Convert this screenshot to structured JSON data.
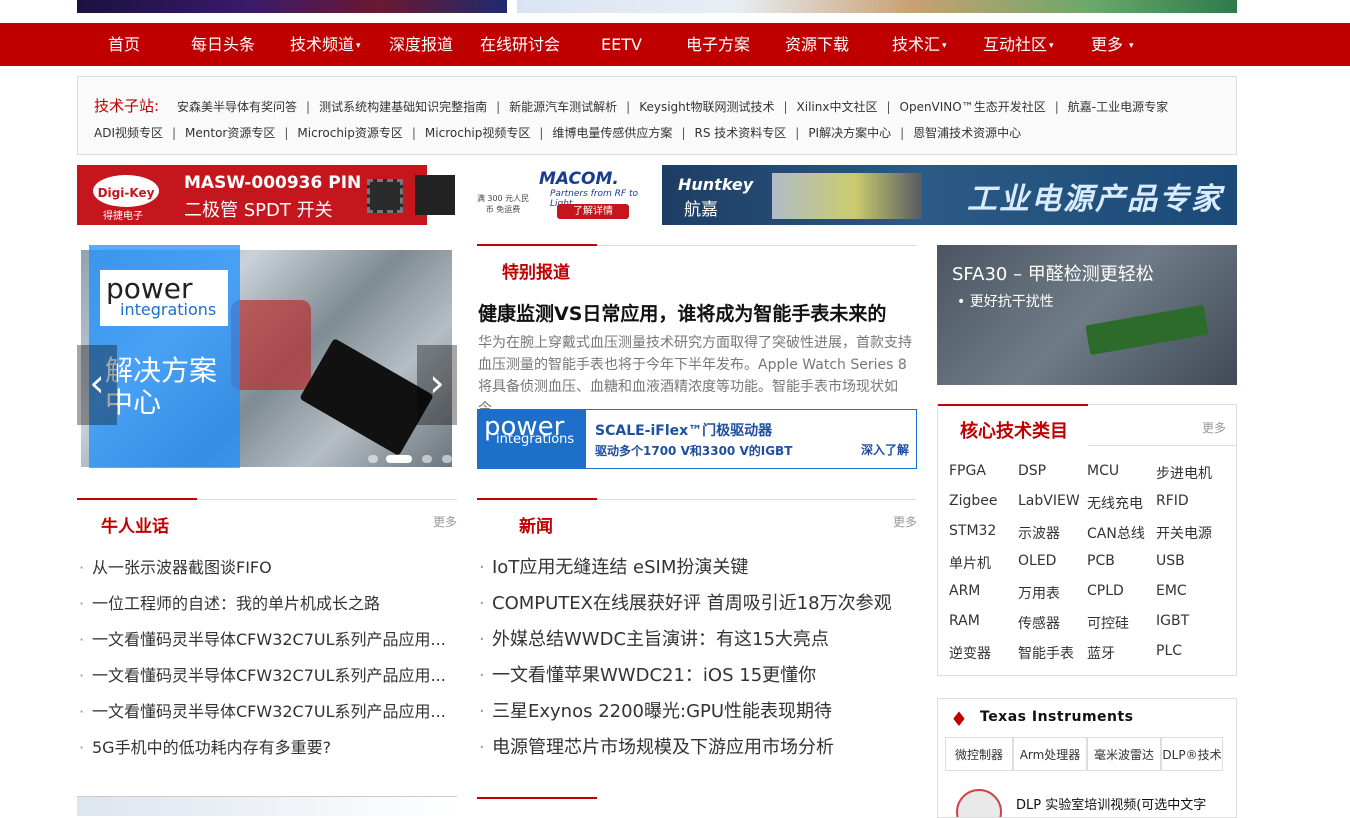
{
  "nav": {
    "items": [
      {
        "label": "首页"
      },
      {
        "label": "每日头条"
      },
      {
        "label": "技术频道",
        "caret": "▾"
      },
      {
        "label": "深度报道"
      },
      {
        "label": "在线研讨会"
      },
      {
        "label": "EETV"
      },
      {
        "label": "电子方案"
      },
      {
        "label": "资源下载"
      },
      {
        "label": "技术汇",
        "caret": "▾"
      },
      {
        "label": "互动社区",
        "caret": "▾"
      },
      {
        "label": "更多",
        "caret": "▾"
      }
    ]
  },
  "subsites": {
    "heading": "技术子站:",
    "row1": [
      "安森美半导体有奖问答",
      "测试系统构建基础知识完整指南",
      "新能源汽车测试解析",
      "Keysight物联网测试技术",
      "Xilinx中文社区",
      "OpenVINO™生态开发社区",
      "航嘉-工业电源专家"
    ],
    "row2": [
      "ADI视频专区",
      "Mentor资源专区",
      "Microchip资源专区",
      "Microchip视频专区",
      "维博电量传感供应方案",
      "RS 技术资料专区",
      "PI解决方案中心",
      "恩智浦技术资源中心"
    ],
    "separator": "|"
  },
  "ads": {
    "digikey": {
      "logo": "Digi-Key",
      "logo_sub": "得捷电子",
      "title": "MASW-000936 PIN",
      "subtitle": "二极管 SPDT 开关",
      "shipping": "满 300 元人民币 免运费",
      "brand": "MACOM.",
      "brand_sub": "Partners from RF to Light",
      "button": "了解详情"
    },
    "huntkey": {
      "logo": "Huntkey",
      "logo_cn": "航嘉",
      "title": "工业电源产品专家"
    },
    "sfa": {
      "title": "SFA30 – 甲醛检测更轻松",
      "bullet": "• 更好抗干扰性"
    },
    "scale": {
      "logo": "power",
      "logo_sub": "integrations",
      "title": "SCALE-iFlex™门极驱动器",
      "subtitle": "驱动多个1700 V和3300 V的IGBT",
      "cta": "深入了解"
    }
  },
  "carousel": {
    "logo": "power",
    "logo_sub": "integrations",
    "caption": "解决方案中心",
    "prev": "‹",
    "next": "›",
    "dots": 4,
    "active_dot": 1
  },
  "special": {
    "title": "特别报道",
    "headline": "健康监测VS日常应用，谁将成为智能手表未来的",
    "desc": "华为在腕上穿戴式血压测量技术研究方面取得了突破性进展，首款支持血压测量的智能手表也将于今年下半年发布。Apple Watch Series 8将具备侦测血压、血糖和血液酒精浓度等功能。智能手表市场现状如今，"
  },
  "niuren": {
    "title": "牛人业话",
    "more": "更多",
    "items": [
      "从一张示波器截图谈FIFO",
      "一位工程师的自述：我的单片机成长之路",
      "一文看懂码灵半导体CFW32C7UL系列产品应用...",
      "一文看懂码灵半导体CFW32C7UL系列产品应用...",
      "一文看懂码灵半导体CFW32C7UL系列产品应用...",
      "5G手机中的低功耗内存有多重要?"
    ]
  },
  "news": {
    "title": "新闻",
    "more": "更多",
    "items": [
      "IoT应用无缝连结 eSIM扮演关键",
      "COMPUTEX在线展获好评 首周吸引近18万次参观",
      "外媒总结WWDC主旨演讲：有这15大亮点",
      "一文看懂苹果WWDC21：iOS 15更懂你",
      "三星Exynos 2200曝光:GPU性能表现期待",
      "电源管理芯片市场规模及下游应用市场分析"
    ]
  },
  "core": {
    "title": "核心技术类目",
    "more": "更多",
    "items": [
      "FPGA",
      "DSP",
      "MCU",
      "步进电机",
      "Zigbee",
      "LabVIEW",
      "无线充电",
      "RFID",
      "STM32",
      "示波器",
      "CAN总线",
      "开关电源",
      "单片机",
      "OLED",
      "PCB",
      "USB",
      "ARM",
      "万用表",
      "CPLD",
      "EMC",
      "RAM",
      "传感器",
      "可控硅",
      "IGBT",
      "逆变器",
      "智能手表",
      "蓝牙",
      "PLC"
    ]
  },
  "ti": {
    "logo": "♦",
    "name": "Texas Instruments",
    "tabs": [
      "微控制器",
      "Arm处理器",
      "毫米波雷达",
      "DLP®技术"
    ],
    "item": "DLP 实验室培训视频(可选中文字"
  },
  "colors": {
    "brand_red": "#c00000",
    "link_gray": "#999999"
  }
}
